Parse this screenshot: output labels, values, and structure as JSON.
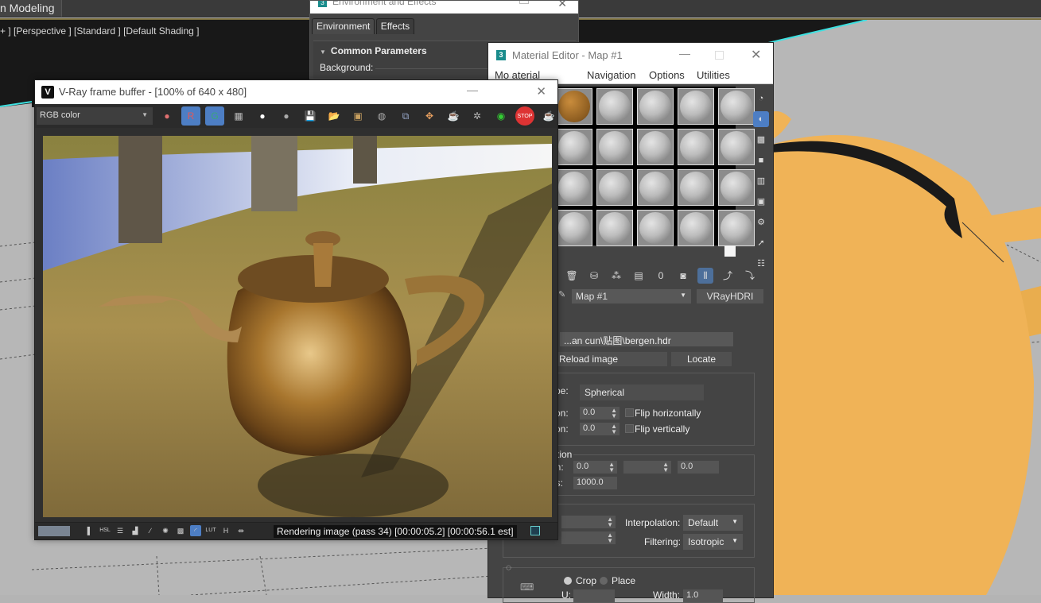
{
  "app": {
    "ribbon_tab": "n Modeling",
    "viewport_label": "+ ] [Perspective ] [Standard ] [Default Shading ]"
  },
  "environment_window": {
    "title": "Environment and Effects",
    "app_icon": "3",
    "tabs": [
      {
        "label": "Environment",
        "active": true
      },
      {
        "label": "Effects",
        "active": false
      }
    ],
    "rollout_title": "Common Parameters",
    "background_label": "Background:"
  },
  "vfb": {
    "title": "V-Ray frame buffer - [100% of 640 x 480]",
    "icon": "V",
    "channel": "RGB color",
    "toolbar_icons": [
      {
        "name": "color-channels-icon",
        "glyph": "●",
        "color": "#e07070",
        "on": false
      },
      {
        "name": "red-channel-icon",
        "glyph": "R",
        "color": "#e05a5a",
        "on": true
      },
      {
        "name": "green-channel-icon",
        "glyph": "G",
        "color": "#3aa87a",
        "on": true
      },
      {
        "name": "mono-icon",
        "glyph": "▦",
        "color": "#bbbbbb",
        "on": false
      },
      {
        "name": "white-dot-icon",
        "glyph": "●",
        "color": "#ffffff",
        "on": false
      },
      {
        "name": "grey-dot-icon",
        "glyph": "●",
        "color": "#aaaaaa",
        "on": false
      },
      {
        "name": "save-icon",
        "glyph": "💾",
        "color": "#9ab",
        "on": false
      },
      {
        "name": "open-folder-icon",
        "glyph": "📂",
        "color": "#d9a640",
        "on": false
      },
      {
        "name": "clear-image-icon",
        "glyph": "▣",
        "color": "#c8a060",
        "on": false
      },
      {
        "name": "duplicate-icon",
        "glyph": "◍",
        "color": "#aaaaaa",
        "on": false
      },
      {
        "name": "track-mouse-icon",
        "glyph": "⧉",
        "color": "#9ac",
        "on": false
      },
      {
        "name": "region-render-icon",
        "glyph": "✥",
        "color": "#e8a060",
        "on": false
      },
      {
        "name": "teapot-render-icon",
        "glyph": "☕",
        "color": "#9bd",
        "on": false
      },
      {
        "name": "interactive-render-icon",
        "glyph": "✲",
        "color": "#bbb",
        "on": false
      },
      {
        "name": "lens-effects-icon",
        "glyph": "◉",
        "color": "#3c3",
        "on": false
      },
      {
        "name": "stop-icon",
        "glyph": "STOP",
        "color": "#d33",
        "on": false
      },
      {
        "name": "render-icon",
        "glyph": "☕",
        "color": "#7bd",
        "on": false
      }
    ],
    "status_icons": [
      {
        "name": "color-correction-icon",
        "glyph": "▌",
        "on": false
      },
      {
        "name": "hsl-icon",
        "glyph": "HSL",
        "on": false
      },
      {
        "name": "levels-icon",
        "glyph": "☰",
        "on": false
      },
      {
        "name": "histogram-icon",
        "glyph": "▟",
        "on": false
      },
      {
        "name": "curves-icon",
        "glyph": "∕",
        "on": false
      },
      {
        "name": "exposure-icon",
        "glyph": "✺",
        "on": false
      },
      {
        "name": "background-image-icon",
        "glyph": "▩",
        "on": false
      },
      {
        "name": "srgb-curve-icon",
        "glyph": "◜",
        "on": true
      },
      {
        "name": "lut-icon",
        "glyph": "LUT",
        "on": false
      },
      {
        "name": "h-icon",
        "glyph": "H",
        "on": false
      },
      {
        "name": "pixel-info-icon",
        "glyph": "⇹",
        "on": false
      }
    ],
    "status_text": "Rendering image (pass 34) [00:00:05.2] [00:00:56.1 est]"
  },
  "material_editor": {
    "title": "Material Editor - Map #1",
    "app_icon": "3",
    "menu": [
      "Modes",
      "Material",
      "Navigation",
      "Options",
      "Utilities"
    ],
    "menu_display": [
      "Mo  aterial",
      "Navigation",
      "Options",
      "Utilities"
    ],
    "slot_count": 20,
    "side_tools": [
      {
        "name": "sample-type-icon",
        "glyph": "◔",
        "on": false
      },
      {
        "name": "backlight-icon",
        "glyph": "◐",
        "on": true
      },
      {
        "name": "background-checker-icon",
        "glyph": "▩",
        "on": false
      },
      {
        "name": "sample-uv-tiling-icon",
        "glyph": "■",
        "on": false
      },
      {
        "name": "video-color-check-icon",
        "glyph": "▥",
        "on": false
      },
      {
        "name": "make-preview-icon",
        "glyph": "▣",
        "on": false
      },
      {
        "name": "options-icon",
        "glyph": "⚙",
        "on": false
      },
      {
        "name": "select-by-material-icon",
        "glyph": "➚",
        "on": false
      },
      {
        "name": "material-map-navigator-icon",
        "glyph": "☷",
        "on": false
      }
    ],
    "bottom_tools": [
      {
        "name": "delete-icon",
        "glyph": "🗑",
        "on": false
      },
      {
        "name": "put-to-library-icon",
        "glyph": "⛁",
        "on": false
      },
      {
        "name": "material-id-icon",
        "glyph": "⁂",
        "on": false
      },
      {
        "name": "save-material-icon",
        "glyph": "▤",
        "on": false
      },
      {
        "name": "material-id-channel-icon",
        "glyph": "0",
        "on": false
      },
      {
        "name": "show-map-in-viewport-icon",
        "glyph": "◙",
        "on": false
      },
      {
        "name": "show-end-result-icon",
        "glyph": "⫴",
        "on": true
      },
      {
        "name": "go-to-parent-icon",
        "glyph": "⤴",
        "on": false
      },
      {
        "name": "go-forward-sibling-icon",
        "glyph": "⤵",
        "on": false
      }
    ],
    "map_name": "Map #1",
    "map_type": "VRayHDRI",
    "bitmap_path": "...an cun\\贴图\\bergen.hdr",
    "reload_label": "Reload image",
    "locate_label": "Locate",
    "mapping_type_label": "ype:",
    "mapping_type": "Spherical",
    "horiz_rotation_label": "tion:",
    "horiz_rotation": "0.0",
    "flip_horizontally_label": "Flip horizontally",
    "vert_rotation_label": "tion:",
    "vert_rotation": "0.0",
    "flip_vertically_label": "Flip vertically",
    "section_label": "ction",
    "pos_label": "on:",
    "pos_x": "0.0",
    "pos_z": "0.0",
    "radius_label": "us:",
    "radius": "1000.0",
    "interpolation_label": "Interpolation:",
    "interpolation": "Default",
    "filtering_label": "Filtering:",
    "filtering": "Isotropic",
    "crop_label": "Crop",
    "place_label": "Place",
    "width_label": "Width:",
    "width_value": "1.0",
    "u_label": "U:"
  }
}
